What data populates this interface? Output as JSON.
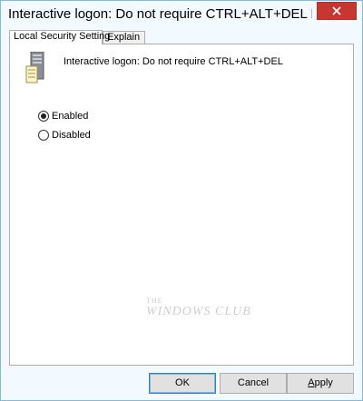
{
  "window": {
    "title": "Interactive logon: Do not require CTRL+ALT+DEL Pro...",
    "close_glyph": "✕"
  },
  "tabs": [
    {
      "label": "Local Security Setting",
      "active": true
    },
    {
      "label": "Explain",
      "active": false
    }
  ],
  "policy": {
    "icon": "server-policy-icon",
    "name": "Interactive logon: Do not require CTRL+ALT+DEL"
  },
  "options": {
    "enabled_label": "Enabled",
    "disabled_label": "Disabled",
    "selected": "Enabled"
  },
  "watermark": {
    "line1": "THE",
    "line2": "WINDOWS CLUB"
  },
  "buttons": {
    "ok": "OK",
    "cancel": "Cancel",
    "apply_prefix": "",
    "apply_accel": "A",
    "apply_rest": "pply"
  },
  "colors": {
    "close": "#c7372f",
    "frame": "#7fbbe9",
    "watermark": "#cfcfcf"
  }
}
